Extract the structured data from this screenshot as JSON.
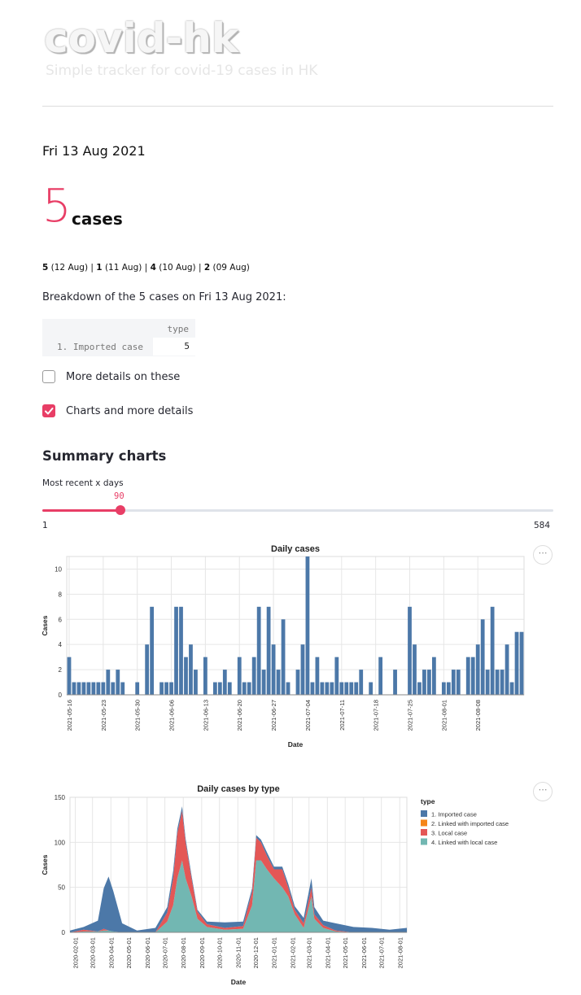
{
  "header": {
    "title": "covid-hk",
    "tagline": "Simple tracker for covid-19 cases in HK"
  },
  "summary": {
    "date": "Fri 13 Aug 2021",
    "count": "5",
    "count_label": "cases",
    "recent": [
      {
        "n": "5",
        "d": "(12 Aug)"
      },
      {
        "n": "1",
        "d": "(11 Aug)"
      },
      {
        "n": "4",
        "d": "(10 Aug)"
      },
      {
        "n": "2",
        "d": "(09 Aug)"
      }
    ],
    "breakdown_text": "Breakdown of the 5 cases on Fri 13 Aug 2021:"
  },
  "breakdown_table": {
    "header": "type",
    "rows": [
      {
        "label": "1. Imported case",
        "value": "5"
      }
    ]
  },
  "checkboxes": [
    {
      "label": "More details on these",
      "checked": false
    },
    {
      "label": "Charts and more details",
      "checked": true
    }
  ],
  "charts_section": {
    "title": "Summary charts",
    "slider_label": "Most recent x days",
    "slider_value": 90,
    "slider_min": 1,
    "slider_max": 584,
    "more_icon": "⋯"
  },
  "colors": {
    "accent": "#e83e66",
    "imported": "#4c78a8",
    "linked_imported": "#f58518",
    "local": "#e45756",
    "linked_local": "#72b7b2"
  },
  "chart_data": [
    {
      "type": "bar",
      "title": "Daily cases",
      "xlabel": "Date",
      "ylabel": "Cases",
      "ylim": [
        0,
        11
      ],
      "yticks": [
        0,
        2,
        4,
        6,
        8,
        10
      ],
      "xticks": [
        "2021-05-16",
        "2021-05-23",
        "2021-05-30",
        "2021-06-06",
        "2021-06-13",
        "2021-06-20",
        "2021-06-27",
        "2021-07-04",
        "2021-07-11",
        "2021-07-18",
        "2021-07-25",
        "2021-08-01",
        "2021-08-08"
      ],
      "start_date": "2021-05-16",
      "values": [
        3,
        1,
        1,
        1,
        1,
        1,
        1,
        1,
        2,
        1,
        2,
        1,
        0,
        0,
        1,
        0,
        4,
        7,
        0,
        1,
        1,
        1,
        7,
        7,
        3,
        4,
        2,
        0,
        3,
        0,
        1,
        1,
        2,
        1,
        0,
        3,
        1,
        1,
        3,
        7,
        2,
        7,
        4,
        2,
        6,
        1,
        0,
        2,
        4,
        11,
        1,
        3,
        1,
        1,
        1,
        3,
        1,
        1,
        1,
        1,
        2,
        0,
        1,
        0,
        3,
        0,
        0,
        2,
        0,
        0,
        7,
        4,
        1,
        2,
        2,
        3,
        0,
        1,
        1,
        2,
        2,
        0,
        3,
        3,
        4,
        6,
        2,
        7,
        2,
        2,
        4,
        1,
        5,
        5
      ]
    },
    {
      "type": "area",
      "title": "Daily cases by type",
      "xlabel": "Date",
      "ylabel": "Cases",
      "ylim": [
        0,
        150
      ],
      "yticks": [
        0,
        50,
        100,
        150
      ],
      "xticks": [
        "2020-02-01",
        "2020-03-01",
        "2020-04-01",
        "2020-05-01",
        "2020-06-01",
        "2020-07-01",
        "2020-08-01",
        "2020-09-01",
        "2020-10-01",
        "2020-11-01",
        "2020-12-01",
        "2021-01-01",
        "2021-02-01",
        "2021-03-01",
        "2021-04-01",
        "2021-05-01",
        "2021-06-01",
        "2021-07-01",
        "2021-08-01"
      ],
      "legend_title": "type",
      "legend_position": "right",
      "series": [
        {
          "name": "1. Imported case",
          "color": "#4c78a8"
        },
        {
          "name": "2. Linked with imported case",
          "color": "#f58518"
        },
        {
          "name": "3. Local case",
          "color": "#e45756"
        },
        {
          "name": "4. Linked with local case",
          "color": "#72b7b2"
        }
      ],
      "dates": [
        "2020-01-23",
        "2020-02-15",
        "2020-03-10",
        "2020-03-20",
        "2020-03-28",
        "2020-04-05",
        "2020-04-20",
        "2020-05-15",
        "2020-06-15",
        "2020-07-05",
        "2020-07-15",
        "2020-07-22",
        "2020-07-30",
        "2020-08-05",
        "2020-08-15",
        "2020-08-25",
        "2020-09-10",
        "2020-10-10",
        "2020-11-10",
        "2020-11-25",
        "2020-12-02",
        "2020-12-10",
        "2020-12-20",
        "2021-01-01",
        "2021-01-15",
        "2021-01-25",
        "2021-02-05",
        "2021-02-20",
        "2021-03-05",
        "2021-03-10",
        "2021-03-25",
        "2021-04-15",
        "2021-05-15",
        "2021-06-15",
        "2021-07-15",
        "2021-08-13"
      ],
      "stacks": [
        [
          2,
          0,
          0,
          0
        ],
        [
          3,
          0,
          2,
          1
        ],
        [
          12,
          0,
          0,
          1
        ],
        [
          45,
          0,
          2,
          2
        ],
        [
          60,
          0,
          0,
          2
        ],
        [
          45,
          0,
          0,
          1
        ],
        [
          10,
          0,
          0,
          0
        ],
        [
          2,
          0,
          0,
          0
        ],
        [
          5,
          0,
          0,
          0
        ],
        [
          6,
          0,
          10,
          12
        ],
        [
          8,
          0,
          30,
          30
        ],
        [
          5,
          0,
          50,
          60
        ],
        [
          5,
          0,
          55,
          80
        ],
        [
          4,
          0,
          40,
          60
        ],
        [
          3,
          0,
          20,
          40
        ],
        [
          2,
          0,
          8,
          15
        ],
        [
          3,
          0,
          3,
          6
        ],
        [
          6,
          0,
          2,
          3
        ],
        [
          5,
          0,
          3,
          4
        ],
        [
          4,
          0,
          15,
          30
        ],
        [
          3,
          0,
          25,
          80
        ],
        [
          3,
          0,
          20,
          80
        ],
        [
          4,
          0,
          15,
          70
        ],
        [
          3,
          0,
          10,
          60
        ],
        [
          3,
          0,
          20,
          50
        ],
        [
          4,
          0,
          10,
          40
        ],
        [
          4,
          0,
          5,
          20
        ],
        [
          6,
          0,
          5,
          5
        ],
        [
          10,
          0,
          10,
          40
        ],
        [
          8,
          0,
          5,
          15
        ],
        [
          5,
          0,
          3,
          5
        ],
        [
          8,
          0,
          1,
          1
        ],
        [
          6,
          0,
          0,
          0
        ],
        [
          5,
          0,
          0,
          0
        ],
        [
          3,
          0,
          0,
          0
        ],
        [
          5,
          0,
          0,
          0
        ]
      ]
    }
  ]
}
